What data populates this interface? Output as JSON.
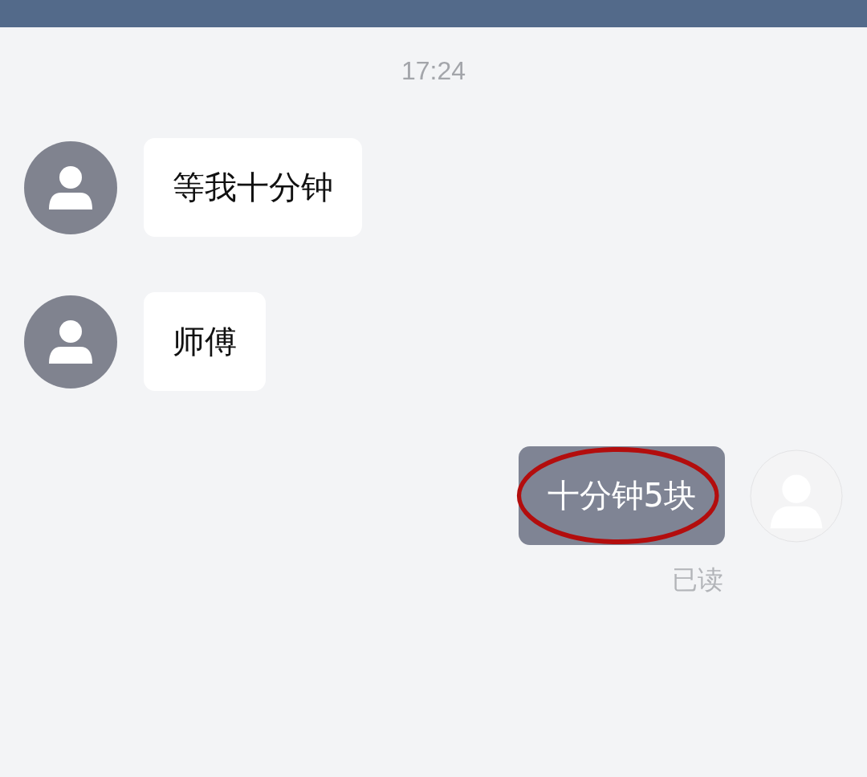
{
  "time": "17:24",
  "messages": [
    {
      "kind": "received",
      "text": "等我十分钟",
      "circled": false
    },
    {
      "kind": "received",
      "text": "师傅",
      "circled": false
    },
    {
      "kind": "sent",
      "text": "十分钟5块",
      "circled": true,
      "receipt": "已读"
    }
  ]
}
